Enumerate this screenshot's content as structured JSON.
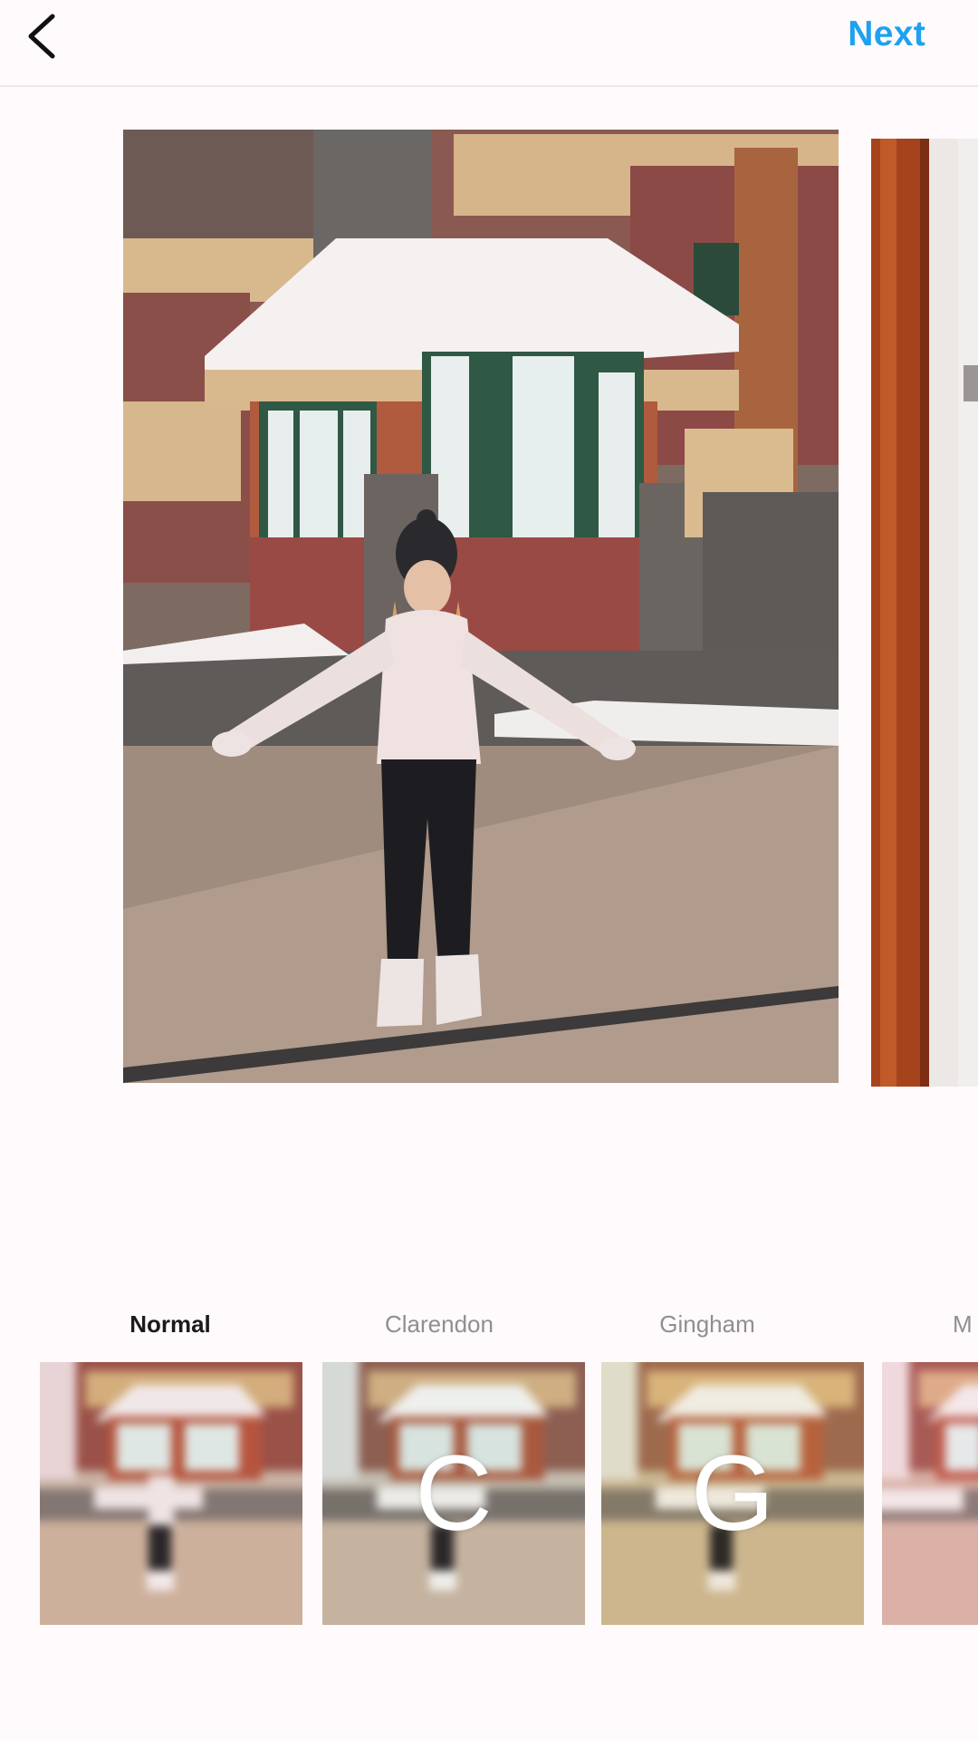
{
  "header": {
    "back_icon": "chevron-left-icon",
    "next_label": "Next",
    "accent_color": "#1ea1f1"
  },
  "filters": [
    {
      "label": "Normal",
      "letter": "",
      "selected": true
    },
    {
      "label": "Clarendon",
      "letter": "C",
      "selected": false
    },
    {
      "label": "Gingham",
      "letter": "G",
      "selected": false
    },
    {
      "label": "M",
      "letter": "",
      "selected": false
    }
  ]
}
